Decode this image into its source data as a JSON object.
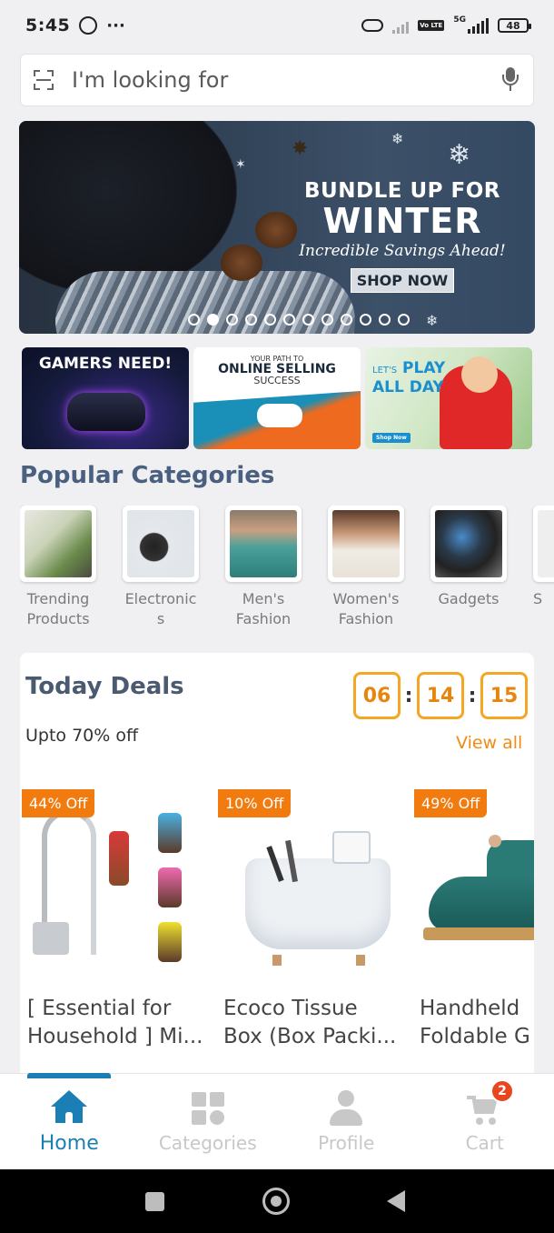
{
  "status_bar": {
    "time": "5:45",
    "dots": "···",
    "battery": "48",
    "volte": "Vo LTE",
    "network": "5G"
  },
  "search": {
    "placeholder": "I'm looking for"
  },
  "hero_banner": {
    "line1": "BUNDLE UP FOR",
    "line2": "WINTER",
    "line3": "Incredible Savings Ahead!",
    "cta": "SHOP NOW",
    "slide_count": 12,
    "active_slide": 2
  },
  "promos": [
    {
      "text": "GAMERS NEED!"
    },
    {
      "small": "YOUR PATH TO",
      "big": "ONLINE SELLING",
      "sub": "SUCCESS"
    },
    {
      "small": "LET'S",
      "big1": "PLAY",
      "big2": "ALL DAY",
      "cta": "Shop Now"
    }
  ],
  "popular_categories": {
    "title": "Popular Categories",
    "items": [
      {
        "label": "Trending Products"
      },
      {
        "label": "Electronics"
      },
      {
        "label": "Men's Fashion"
      },
      {
        "label": "Women's Fashion"
      },
      {
        "label": "Gadgets"
      },
      {
        "label": "S"
      }
    ]
  },
  "today_deals": {
    "title": "Today Deals",
    "subtitle": "Upto 70% off",
    "view_all": "View all",
    "timer": {
      "hours": "06",
      "minutes": "14",
      "seconds": "15"
    },
    "products": [
      {
        "discount": "44% Off",
        "name_line1": "[ Essential for",
        "name_line2": "Household ] Mi..."
      },
      {
        "discount": "10% Off",
        "name_line1": "Ecoco Tissue",
        "name_line2": "Box (Box Packi..."
      },
      {
        "discount": "49% Off",
        "name_line1": "Handheld",
        "name_line2": "Foldable G"
      }
    ]
  },
  "bottom_nav": {
    "items": [
      {
        "label": "Home",
        "active": true
      },
      {
        "label": "Categories",
        "active": false
      },
      {
        "label": "Profile",
        "active": false
      },
      {
        "label": "Cart",
        "active": false
      }
    ],
    "cart_count": "2"
  },
  "colors": {
    "accent_blue": "#1b7fb5",
    "deal_orange": "#f27b10",
    "timer_orange": "#f5a623",
    "heading": "#4a6080",
    "badge_red": "#e8461f"
  }
}
